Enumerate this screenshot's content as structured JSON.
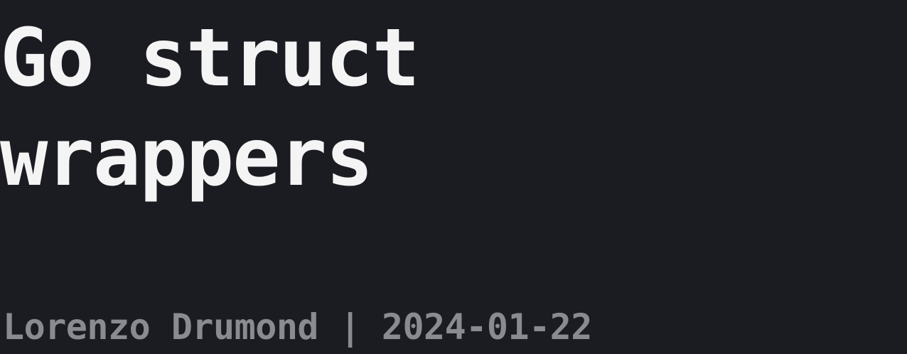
{
  "post": {
    "title_line1": "Go struct",
    "title_line2": "wrappers",
    "byline": "Lorenzo Drumond | 2024-01-22"
  },
  "colors": {
    "background": "#1b1c21",
    "title": "#f4f4f5",
    "byline": "#8a8b90"
  }
}
